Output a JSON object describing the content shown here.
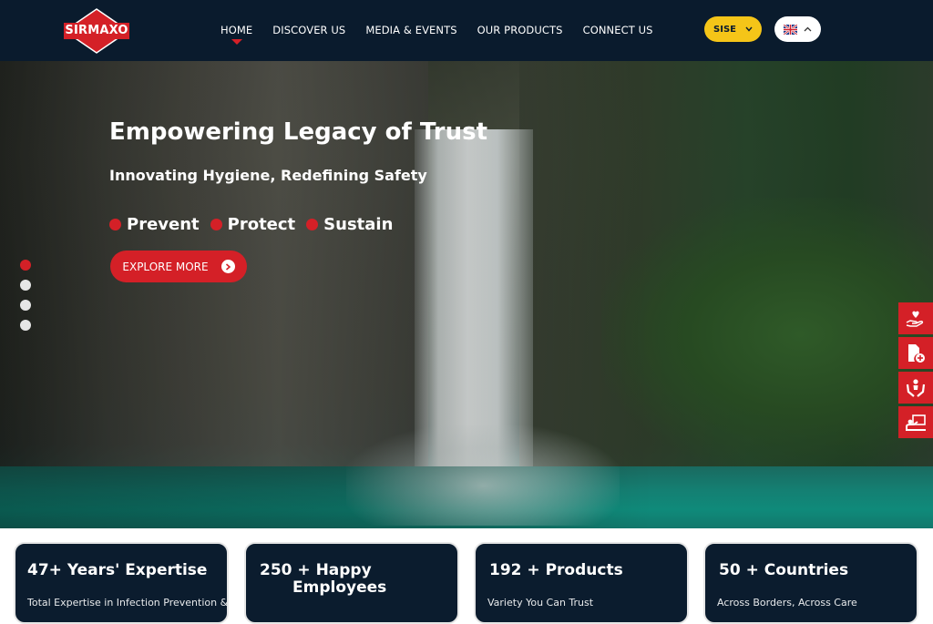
{
  "brand": {
    "logo_text": "SIRMAXO",
    "accent": "#d42027",
    "nav_bg": "#0a1b2d",
    "yellow": "#f5c518"
  },
  "nav": {
    "items": [
      {
        "label": "HOME",
        "active": true
      },
      {
        "label": "DISCOVER US"
      },
      {
        "label": "MEDIA & EVENTS"
      },
      {
        "label": "OUR PRODUCTS"
      },
      {
        "label": "CONNECT US"
      }
    ],
    "sise_label": "SISE",
    "sise_icon": "chevron-down-icon",
    "language_icon": "uk-flag-icon",
    "language_toggle_icon": "chevron-up-icon"
  },
  "hero": {
    "title": "Empowering Legacy of Trust",
    "subtitle": "Innovating Hygiene, Redefining Safety",
    "pillars": [
      "Prevent",
      "Protect",
      "Sustain"
    ],
    "cta_label": "EXPLORE MORE",
    "cta_icon": "chevron-right-icon",
    "slides": 4,
    "active_slide": 1
  },
  "side_tools": [
    {
      "icon": "hand-heart-icon"
    },
    {
      "icon": "document-plus-icon"
    },
    {
      "icon": "hands-care-icon"
    },
    {
      "icon": "presentation-icon"
    }
  ],
  "stats": [
    {
      "title": "47+ Years' Expertise",
      "description": "Total Expertise in Infection Prevention &"
    },
    {
      "title": "250 + Happy Employees",
      "title_line1": "250 + Happy",
      "title_line2": "Employees",
      "description": ""
    },
    {
      "title": "192 + Products",
      "description": "Variety You Can Trust"
    },
    {
      "title": "50 + Countries",
      "description": "Across Borders, Across Care"
    }
  ]
}
